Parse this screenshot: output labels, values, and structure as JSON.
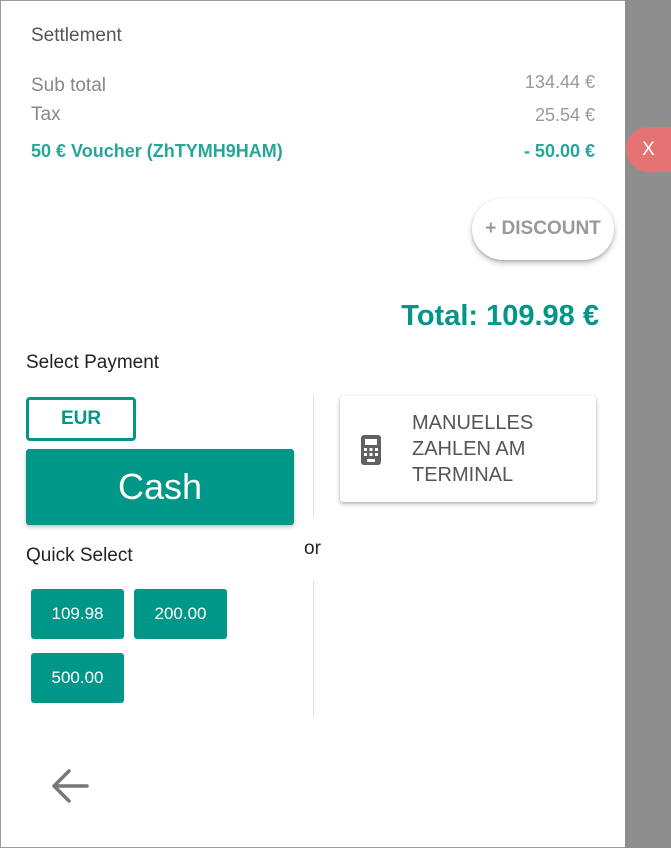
{
  "settlement": {
    "title": "Settlement",
    "subtotal_label": "Sub total",
    "subtotal_value": "134.44 €",
    "tax_label": "Tax",
    "tax_value": "25.54 €",
    "voucher_label": "50 € Voucher (ZhTYMH9HAM)",
    "voucher_value": "- 50.00 €",
    "discount_button": "+ DISCOUNT",
    "total": "Total: 109.98 €"
  },
  "close_button": "X",
  "payment": {
    "select_label": "Select Payment",
    "currency": "EUR",
    "cash_label": "Cash",
    "or_label": "or",
    "terminal_label": "MANUELLES\nZAHLEN AM\nTERMINAL",
    "terminal_icon": "card-terminal-icon"
  },
  "quick_select": {
    "label": "Quick Select",
    "amounts": [
      "109.98",
      "200.00",
      "500.00"
    ]
  },
  "navigation": {
    "back_icon": "arrow-left-icon"
  },
  "colors": {
    "accent": "#009688",
    "voucher": "#26a69a",
    "close": "#e57373"
  }
}
